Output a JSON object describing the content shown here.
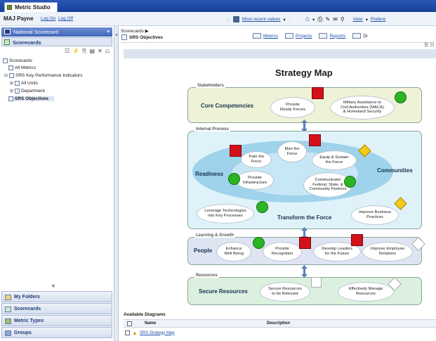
{
  "app": {
    "title": "Metric Studio"
  },
  "user": {
    "name": "MAJ Payne",
    "log_on": "Log On",
    "log_off": "Log Off"
  },
  "topbar": {
    "most_recent": "Most recent values",
    "view": "View",
    "preferences": "Prefere"
  },
  "left": {
    "scorecard_dropdown": "National Scorecard",
    "section_title": "Scorecards",
    "toolbar_glyphs": [
      "☷",
      "⚡",
      "⎘",
      "▤",
      "✕",
      "⎌"
    ],
    "tree": {
      "root": "Scorecards",
      "all_metrics": "All Metrics",
      "kpi": "SRS Key Performance Indicators",
      "all_units": "All Units",
      "department": "Department",
      "srs_objectives": "SRS Objectives"
    },
    "collapse": "¥",
    "nav": [
      "My Folders",
      "Scorecards",
      "Metric Types",
      "Groups"
    ]
  },
  "main": {
    "breadcrumb": "Scorecards ▶",
    "page_title": "SRS Objectives",
    "tabs": [
      "Metrics",
      "Projects",
      "Reports",
      "Di"
    ],
    "toolbar_glyph": "☰ ☷"
  },
  "map": {
    "title": "Strategy Map",
    "perspectives": {
      "stakeholders": "Stakeholders",
      "internal": "Internal Process",
      "learning": "Learning & Growth",
      "resources": "Resources"
    },
    "themes": {
      "core": "Core Competencies",
      "readiness": "Readiness",
      "communities": "Communities",
      "transform": "Transform the Force",
      "people": "People",
      "secure": "Secure Resources"
    },
    "objectives": {
      "ready_forces": "Provide\nReady Forces",
      "maca": "Military Assistance to\nCivil Authorities (MACA)\n& Homeland Security",
      "man_force": "Man the\nForce",
      "train_force": "Train the\nForce",
      "equip": "Equip & Sustain\nthe Force",
      "infrastructure": "Provide\nInfrastructure",
      "communicate": "Communicate/\nFederal, State, &\nCommunity Partners",
      "leverage": "Leverage Technologies\ninto Key Processes",
      "business": "Improve Business\nPractices",
      "wellbeing": "Enhance\nWell Being",
      "recognition": "Provide\nRecognition",
      "leaders": "Develop Leaders\nfor the Future",
      "employee": "Improve Employee\nRelations",
      "secure_relevant": "Secure Resources\nto be Relevant",
      "manage_resources": "Effectively Manage\nResources"
    }
  },
  "diagrams": {
    "heading": "Available Diagrams",
    "col_name": "Name",
    "col_desc": "Description",
    "row": "SRS Strategy Map"
  },
  "colors": {
    "red": "#d4101a",
    "green": "#2bb523",
    "yellow": "#f4cc18",
    "brand": "#1a3f96"
  }
}
